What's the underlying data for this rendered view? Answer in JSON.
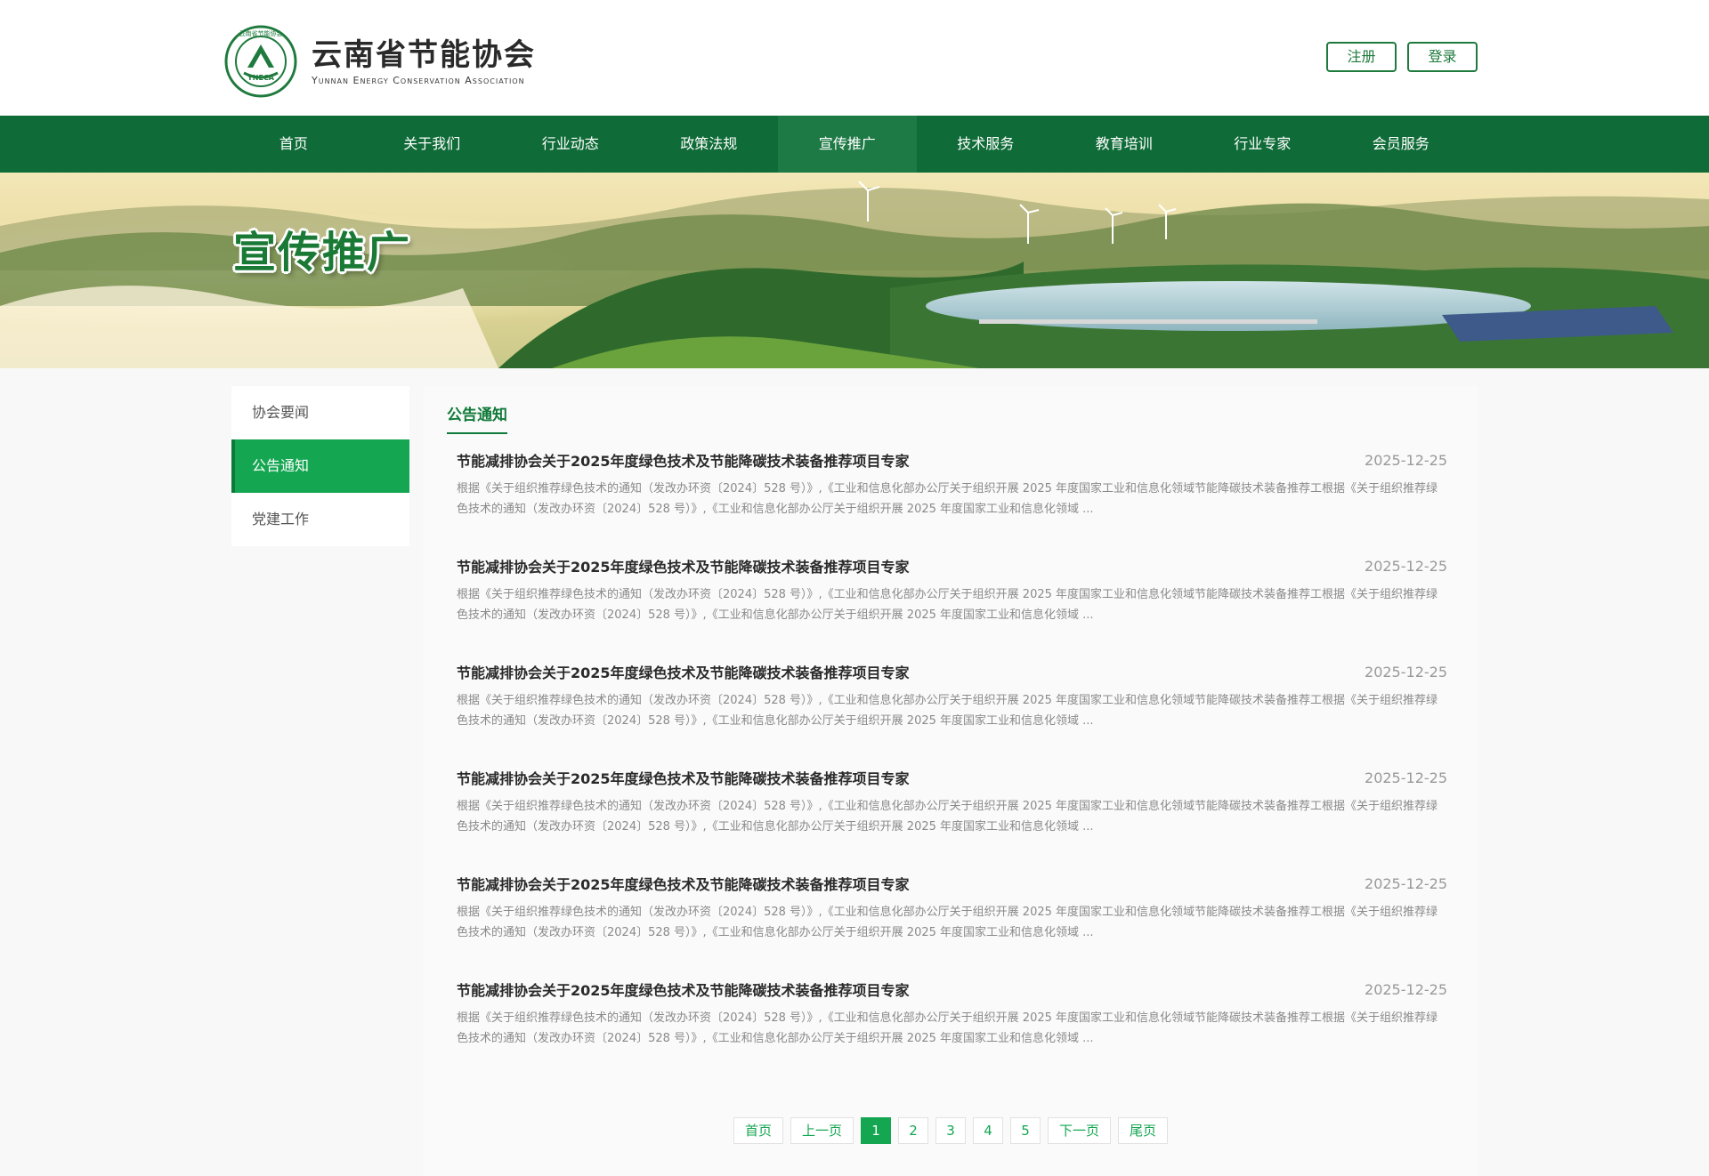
{
  "header": {
    "logo_cn": "云南省节能协会",
    "logo_en": "Yunnan Energy Conservation Association",
    "logo_ring_text": "云南省节能协会",
    "logo_abbr": "YNECA",
    "register_label": "注册",
    "login_label": "登录"
  },
  "nav": {
    "items": [
      {
        "label": "首页"
      },
      {
        "label": "关于我们"
      },
      {
        "label": "行业动态"
      },
      {
        "label": "政策法规"
      },
      {
        "label": "宣传推广"
      },
      {
        "label": "技术服务"
      },
      {
        "label": "教育培训"
      },
      {
        "label": "行业专家"
      },
      {
        "label": "会员服务"
      }
    ],
    "active": "宣传推广"
  },
  "banner": {
    "title": "宣传推广"
  },
  "sidebar": {
    "items": [
      {
        "label": "协会要闻"
      },
      {
        "label": "公告通知"
      },
      {
        "label": "党建工作"
      }
    ],
    "active": "公告通知"
  },
  "main": {
    "section_title": "公告通知",
    "news": [
      {
        "title": "节能减排协会关于2025年度绿色技术及节能降碳技术装备推荐项目专家",
        "date": "2025-12-25",
        "desc": "根据《关于组织推荐绿色技术的通知（发改办环资〔2024〕528 号）》,《工业和信息化部办公厅关于组织开展 2025 年度国家工业和信息化领域节能降碳技术装备推荐工根据《关于组织推荐绿色技术的通知（发改办环资〔2024〕528 号）》,《工业和信息化部办公厅关于组织开展 2025 年度国家工业和信息化领域 ..."
      },
      {
        "title": "节能减排协会关于2025年度绿色技术及节能降碳技术装备推荐项目专家",
        "date": "2025-12-25",
        "desc": "根据《关于组织推荐绿色技术的通知（发改办环资〔2024〕528 号）》,《工业和信息化部办公厅关于组织开展 2025 年度国家工业和信息化领域节能降碳技术装备推荐工根据《关于组织推荐绿色技术的通知（发改办环资〔2024〕528 号）》,《工业和信息化部办公厅关于组织开展 2025 年度国家工业和信息化领域 ..."
      },
      {
        "title": "节能减排协会关于2025年度绿色技术及节能降碳技术装备推荐项目专家",
        "date": "2025-12-25",
        "desc": "根据《关于组织推荐绿色技术的通知（发改办环资〔2024〕528 号）》,《工业和信息化部办公厅关于组织开展 2025 年度国家工业和信息化领域节能降碳技术装备推荐工根据《关于组织推荐绿色技术的通知（发改办环资〔2024〕528 号）》,《工业和信息化部办公厅关于组织开展 2025 年度国家工业和信息化领域 ..."
      },
      {
        "title": "节能减排协会关于2025年度绿色技术及节能降碳技术装备推荐项目专家",
        "date": "2025-12-25",
        "desc": "根据《关于组织推荐绿色技术的通知（发改办环资〔2024〕528 号）》,《工业和信息化部办公厅关于组织开展 2025 年度国家工业和信息化领域节能降碳技术装备推荐工根据《关于组织推荐绿色技术的通知（发改办环资〔2024〕528 号）》,《工业和信息化部办公厅关于组织开展 2025 年度国家工业和信息化领域 ..."
      },
      {
        "title": "节能减排协会关于2025年度绿色技术及节能降碳技术装备推荐项目专家",
        "date": "2025-12-25",
        "desc": "根据《关于组织推荐绿色技术的通知（发改办环资〔2024〕528 号）》,《工业和信息化部办公厅关于组织开展 2025 年度国家工业和信息化领域节能降碳技术装备推荐工根据《关于组织推荐绿色技术的通知（发改办环资〔2024〕528 号）》,《工业和信息化部办公厅关于组织开展 2025 年度国家工业和信息化领域 ..."
      },
      {
        "title": "节能减排协会关于2025年度绿色技术及节能降碳技术装备推荐项目专家",
        "date": "2025-12-25",
        "desc": "根据《关于组织推荐绿色技术的通知（发改办环资〔2024〕528 号）》,《工业和信息化部办公厅关于组织开展 2025 年度国家工业和信息化领域节能降碳技术装备推荐工根据《关于组织推荐绿色技术的通知（发改办环资〔2024〕528 号）》,《工业和信息化部办公厅关于组织开展 2025 年度国家工业和信息化领域 ..."
      }
    ]
  },
  "pager": {
    "first": "首页",
    "prev": "上一页",
    "pages": [
      "1",
      "2",
      "3",
      "4",
      "5"
    ],
    "current": "1",
    "next": "下一页",
    "last": "尾页"
  },
  "colors": {
    "brand_dark": "#0f6b37",
    "brand": "#14a651",
    "accent_text": "#117a3a"
  }
}
